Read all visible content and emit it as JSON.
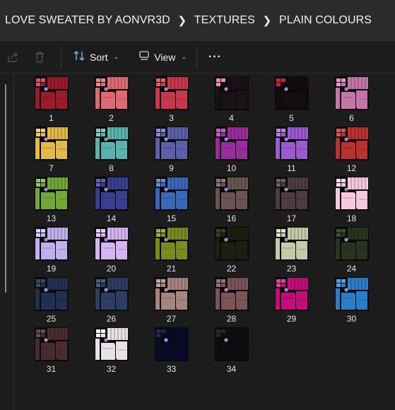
{
  "breadcrumb": [
    "LOVE SWEATER BY AONVR3D",
    "TEXTURES",
    "PLAIN COLOURS"
  ],
  "toolbar": {
    "sort_label": "Sort",
    "view_label": "View",
    "more_label": "···"
  },
  "files": [
    {
      "name": "1",
      "color": "#9b1b2b",
      "accent": "#e05070"
    },
    {
      "name": "2",
      "color": "#e06a72",
      "accent": "#f08890"
    },
    {
      "name": "3",
      "color": "#c8384c",
      "accent": "#e06070"
    },
    {
      "name": "4",
      "color": "#1a1214",
      "accent": "#f090a0"
    },
    {
      "name": "5",
      "color": "#140c0e",
      "accent": "#d02038"
    },
    {
      "name": "6",
      "color": "#c676a6",
      "accent": "#e79ac7"
    },
    {
      "name": "7",
      "color": "#e3b94a",
      "accent": "#f0d070"
    },
    {
      "name": "8",
      "color": "#5ab4ae",
      "accent": "#80d0c8"
    },
    {
      "name": "9",
      "color": "#5d60a8",
      "accent": "#8a8ed0"
    },
    {
      "name": "10",
      "color": "#9a2d9c",
      "accent": "#c55ac8"
    },
    {
      "name": "11",
      "color": "#9b5ad0",
      "accent": "#b980e8"
    },
    {
      "name": "12",
      "color": "#b8332f",
      "accent": "#d85550"
    },
    {
      "name": "13",
      "color": "#72a83a",
      "accent": "#98c860"
    },
    {
      "name": "14",
      "color": "#3a3e90",
      "accent": "#5e62b8"
    },
    {
      "name": "15",
      "color": "#3a68b8",
      "accent": "#6090d8"
    },
    {
      "name": "16",
      "color": "#6a5454",
      "accent": "#907575"
    },
    {
      "name": "17",
      "color": "#4e3c3e",
      "accent": "#706062"
    },
    {
      "name": "18",
      "color": "#f6c8de",
      "accent": "#ffe0ee"
    },
    {
      "name": "19",
      "color": "#c0b0f0",
      "accent": "#dcd0ff"
    },
    {
      "name": "20",
      "color": "#d6b4f2",
      "accent": "#e8d0ff"
    },
    {
      "name": "21",
      "color": "#7c8a20",
      "accent": "#a0b040"
    },
    {
      "name": "22",
      "color": "#1c2010",
      "accent": "#3a4020"
    },
    {
      "name": "23",
      "color": "#c2cca8",
      "accent": "#dce4c8"
    },
    {
      "name": "24",
      "color": "#263420",
      "accent": "#405038"
    },
    {
      "name": "25",
      "color": "#223050",
      "accent": "#3a4870"
    },
    {
      "name": "26",
      "color": "#2c3e66",
      "accent": "#4a5e88"
    },
    {
      "name": "27",
      "color": "#a6857e",
      "accent": "#c4a49c"
    },
    {
      "name": "28",
      "color": "#7a5458",
      "accent": "#9a7478"
    },
    {
      "name": "29",
      "color": "#c40c7a",
      "accent": "#e040a0"
    },
    {
      "name": "30",
      "color": "#2a7ec8",
      "accent": "#50a0e8"
    },
    {
      "name": "31",
      "color": "#4a2c30",
      "accent": "#6a4a4e"
    },
    {
      "name": "32",
      "color": "#e8e2e2",
      "accent": "#ffffff"
    },
    {
      "name": "33",
      "color": "#080a2a",
      "accent": "#202458"
    },
    {
      "name": "34",
      "color": "#0e0e0e",
      "accent": "#2a2a2a"
    }
  ]
}
